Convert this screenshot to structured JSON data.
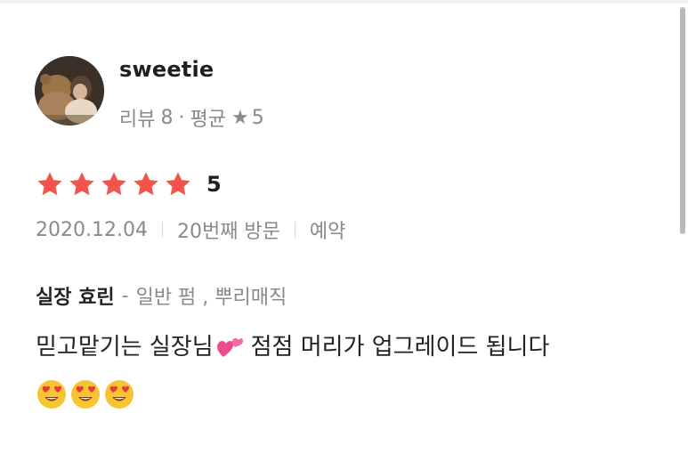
{
  "user": {
    "name": "sweetie",
    "review_label": "리뷰",
    "review_count": "8",
    "dot": "·",
    "avg_label": "평균",
    "avg_star": "★",
    "avg_value": "5"
  },
  "review": {
    "stars": 5,
    "rating_text": "5",
    "date": "2020.12.04",
    "visit": "20번째 방문",
    "booking": "예약",
    "designer": "실장 효린",
    "services_sep": "-",
    "services": "일반 펌 , 뿌리매직",
    "text_part1": "믿고맡기는 실장님",
    "text_part2": "점점 머리가 업그레이드 됩니다",
    "emoji_heart": "two-hearts-emoji",
    "emoji_smile": "heart-eyes-emoji",
    "emoji_smile_count": 3
  },
  "colors": {
    "star": "#f2544b",
    "muted_text": "#8a8a8a",
    "primary_text": "#222222"
  }
}
